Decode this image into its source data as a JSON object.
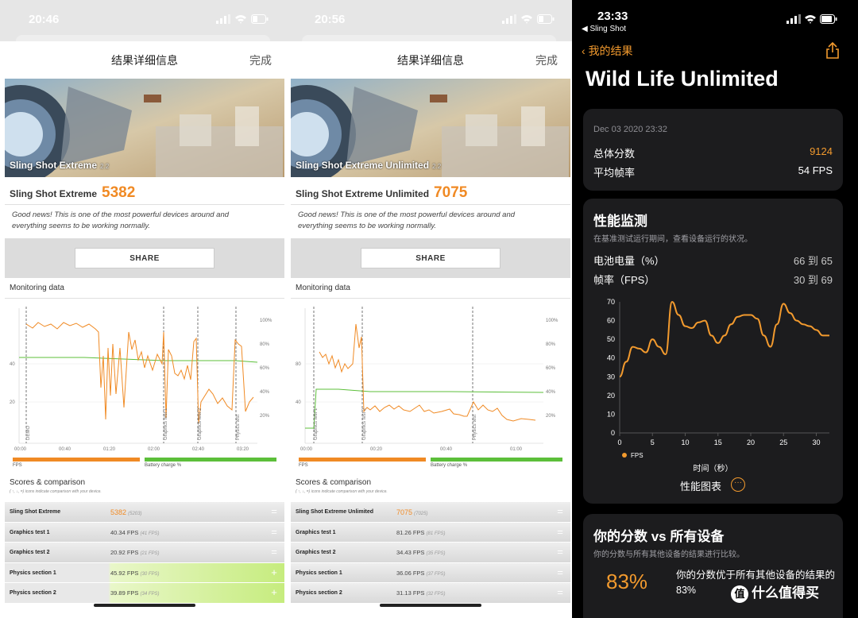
{
  "left": {
    "status_time": "20:46",
    "sheet_title": "结果详细信息",
    "done": "完成",
    "hero_label": "Sling Shot Extreme",
    "hero_num": "2.2",
    "score_label": "Sling Shot Extreme",
    "score": "5382",
    "message": "Good news! This is one of the most powerful devices around and everything seems to be working normally.",
    "share": "SHARE",
    "monitoring_title": "Monitoring data",
    "legend_fps": "FPS",
    "legend_battery": "Battery charge %",
    "scores_title": "Scores & comparison",
    "scores_note": "( ↑, ↓, =) icons indicate comparison with your device.",
    "rows": [
      {
        "name": "Sling Shot Extreme",
        "value": "5382",
        "sub": "(5203)",
        "action": "="
      },
      {
        "name": "Graphics test 1",
        "value": "40.34 FPS",
        "sub": "(41 FPS)",
        "action": "="
      },
      {
        "name": "Graphics test 2",
        "value": "20.92 FPS",
        "sub": "(21 FPS)",
        "action": "="
      },
      {
        "name": "Physics section 1",
        "value": "45.92 FPS",
        "sub": "(30 FPS)",
        "action": "+"
      },
      {
        "name": "Physics section 2",
        "value": "39.89 FPS",
        "sub": "(34 FPS)",
        "action": "+"
      }
    ],
    "chart": {
      "left_ticks": [
        "40",
        "20"
      ],
      "right_ticks": [
        "100%",
        "80%",
        "60%",
        "40%",
        "20%"
      ],
      "x_ticks": [
        "00:00",
        "00:40",
        "01:20",
        "02:00",
        "02:40",
        "03:20"
      ],
      "markers": [
        "DEMO",
        "Graphics test 1",
        "Graphics test 2",
        "Physics test"
      ]
    }
  },
  "mid": {
    "status_time": "20:56",
    "sheet_title": "结果详细信息",
    "done": "完成",
    "hero_label": "Sling Shot Extreme Unlimited",
    "hero_num": "2.2",
    "score_label": "Sling Shot Extreme Unlimited",
    "score": "7075",
    "message": "Good news! This is one of the most powerful devices around and everything seems to be working normally.",
    "share": "SHARE",
    "monitoring_title": "Monitoring data",
    "legend_fps": "FPS",
    "legend_battery": "Battery charge %",
    "scores_title": "Scores & comparison",
    "scores_note": "( ↑, ↓, =) icons indicate comparison with your device.",
    "rows": [
      {
        "name": "Sling Shot Extreme Unlimited",
        "value": "7075",
        "sub": "(7025)",
        "action": "="
      },
      {
        "name": "Graphics test 1",
        "value": "81.26 FPS",
        "sub": "(81 FPS)",
        "action": "="
      },
      {
        "name": "Graphics test 2",
        "value": "34.43 FPS",
        "sub": "(35 FPS)",
        "action": "="
      },
      {
        "name": "Physics section 1",
        "value": "36.06 FPS",
        "sub": "(37 FPS)",
        "action": "="
      },
      {
        "name": "Physics section 2",
        "value": "31.13 FPS",
        "sub": "(32 FPS)",
        "action": "="
      }
    ],
    "chart": {
      "left_ticks": [
        "80",
        "40"
      ],
      "right_ticks": [
        "100%",
        "80%",
        "60%",
        "40%",
        "20%"
      ],
      "x_ticks": [
        "00:00",
        "00:20",
        "00:40",
        "01:00"
      ],
      "markers": [
        "Graphics test 1",
        "Graphics test 2",
        "Physics test"
      ]
    }
  },
  "right": {
    "status_time": "23:33",
    "back_app": "◀ Sling Shot",
    "nav_back": "我的结果",
    "title": "Wild Life Unlimited",
    "date": "Dec 03 2020 23:32",
    "total_label": "总体分数",
    "total_value": "9124",
    "avg_label": "平均帧率",
    "avg_value": "54 FPS",
    "perf_title": "性能监测",
    "perf_sub": "在基准测试运行期间，查看设备运行的状况。",
    "battery_label": "电池电量（%）",
    "battery_value": "66 到 65",
    "fps_label": "帧率（FPS）",
    "fps_value": "30 到 69",
    "axis_title": "时间（秒）",
    "more_label": "性能图表",
    "cmp_title": "你的分数 vs 所有设备",
    "cmp_sub": "你的分数与所有其他设备的结果进行比较。",
    "percent": "83%",
    "percent_desc": "你的分数优于所有其他设备的结果的 83%",
    "watermark": "什么值得买"
  },
  "chart_data": {
    "type": "line",
    "xlabel": "时间（秒）",
    "ylabel": "",
    "xlim": [
      0,
      32
    ],
    "ylim": [
      0,
      70
    ],
    "x_ticks": [
      0,
      5,
      10,
      15,
      20,
      25,
      30
    ],
    "y_ticks": [
      0,
      10,
      20,
      30,
      40,
      50,
      60,
      70
    ],
    "series": [
      {
        "name": "FPS",
        "color": "#f29a2e",
        "x": [
          0,
          1,
          2,
          3,
          4,
          5,
          6,
          7,
          8,
          9,
          10,
          11,
          12,
          13,
          14,
          15,
          16,
          17,
          18,
          19,
          20,
          21,
          22,
          23,
          24,
          25,
          26,
          27,
          28,
          29,
          30,
          31,
          32
        ],
        "y": [
          30,
          38,
          46,
          45,
          43,
          50,
          46,
          42,
          70,
          63,
          57,
          56,
          59,
          60,
          52,
          48,
          52,
          58,
          62,
          63,
          63,
          61,
          52,
          46,
          58,
          69,
          64,
          60,
          58,
          57,
          55,
          52,
          52
        ]
      }
    ]
  }
}
